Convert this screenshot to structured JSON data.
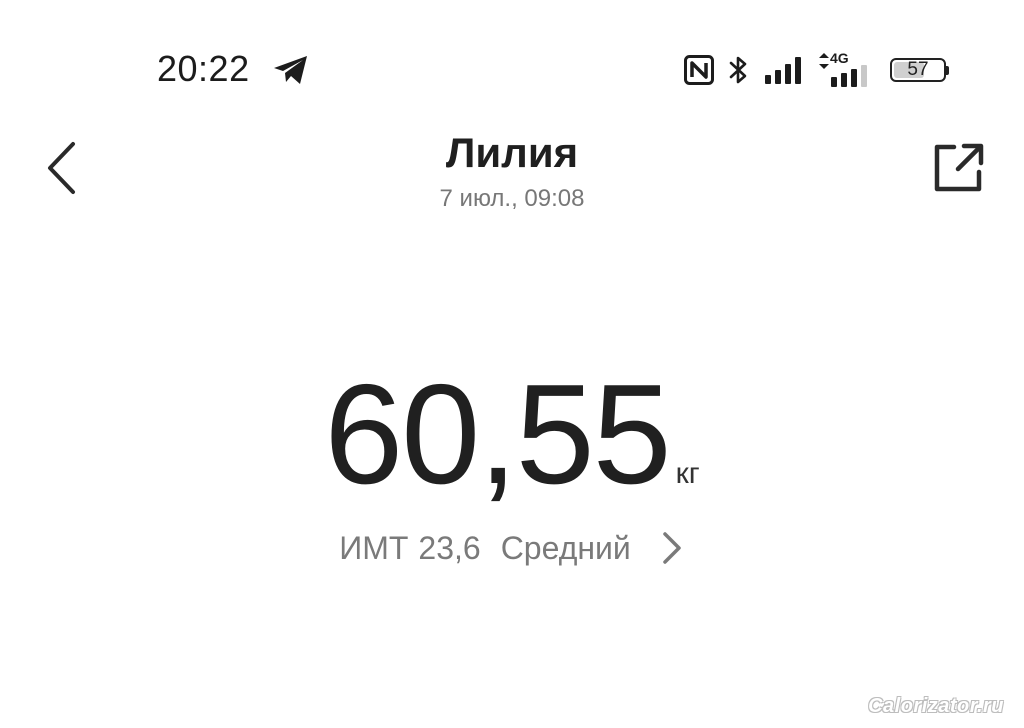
{
  "status_bar": {
    "time": "20:22",
    "icons": [
      "telegram-icon",
      "nfc-icon",
      "bluetooth-icon",
      "cell-signal-icon",
      "4g-signal-icon",
      "battery-icon"
    ],
    "network_label": "4G",
    "battery_level": "57"
  },
  "header": {
    "title": "Лилия",
    "subtitle": "7 июл., 09:08",
    "back_icon": "chevron-left-icon",
    "share_icon": "share-external-icon"
  },
  "measurement": {
    "weight": "60,55",
    "unit": "кг",
    "bmi_label": "ИМТ",
    "bmi_value": "23,6",
    "bmi_category": "Средний",
    "detail_icon": "chevron-right-icon"
  },
  "watermark": "Calorizator.ru"
}
